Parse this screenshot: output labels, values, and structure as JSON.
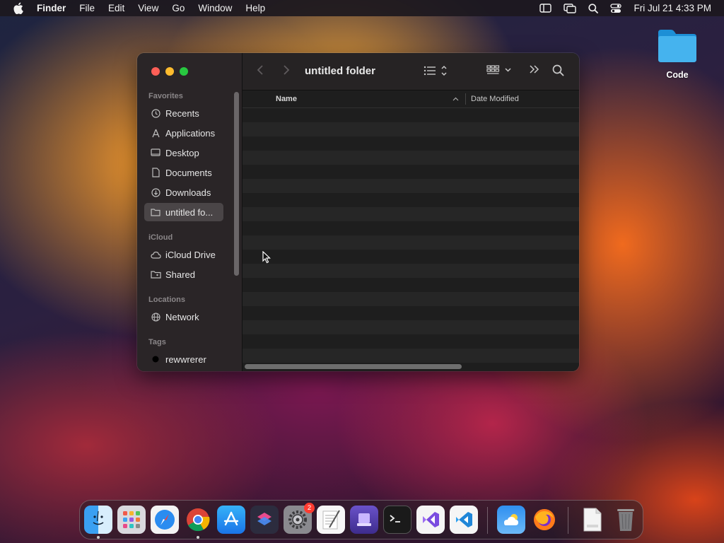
{
  "menubar": {
    "app_name": "Finder",
    "menus": [
      "File",
      "Edit",
      "View",
      "Go",
      "Window",
      "Help"
    ],
    "clock": "Fri Jul 21  4:33 PM",
    "status_icons": [
      "sidebar-icon",
      "screen-mirroring-icon",
      "spotlight-search-icon",
      "control-center-icon"
    ]
  },
  "desktop": {
    "folder_label": "Code"
  },
  "window": {
    "title": "untitled folder",
    "sidebar": {
      "sections": {
        "favorites": "Favorites",
        "icloud": "iCloud",
        "locations": "Locations",
        "tags": "Tags"
      },
      "favorites": [
        {
          "label": "Recents",
          "icon": "clock-icon"
        },
        {
          "label": "Applications",
          "icon": "applications-icon"
        },
        {
          "label": "Desktop",
          "icon": "desktop-icon"
        },
        {
          "label": "Documents",
          "icon": "document-icon"
        },
        {
          "label": "Downloads",
          "icon": "download-icon"
        },
        {
          "label": "untitled fo...",
          "icon": "folder-icon",
          "selected": true
        }
      ],
      "icloud": [
        {
          "label": "iCloud Drive",
          "icon": "cloud-icon"
        },
        {
          "label": "Shared",
          "icon": "shared-folder-icon"
        }
      ],
      "locations": [
        {
          "label": "Network",
          "icon": "globe-icon"
        }
      ],
      "tags": [
        {
          "label": "rewwrerer",
          "icon": "tag-dot-icon",
          "color": "#000000"
        }
      ]
    },
    "columns": {
      "name": "Name",
      "date_modified": "Date Modified"
    }
  },
  "dock": {
    "apps": [
      "Finder",
      "Launchpad",
      "Safari",
      "Google Chrome",
      "App Store",
      "Shortcuts",
      "System Settings",
      "TextEdit",
      "Ventura Installer",
      "Terminal",
      "Visual Studio",
      "Visual Studio Code",
      "Weather",
      "Firefox",
      "HTML Document",
      "Trash"
    ],
    "settings_badge": "2"
  },
  "colors": {
    "close": "#fe5f57",
    "minimize": "#febc2e",
    "maximize": "#28c840",
    "badge": "#ff3b30"
  }
}
